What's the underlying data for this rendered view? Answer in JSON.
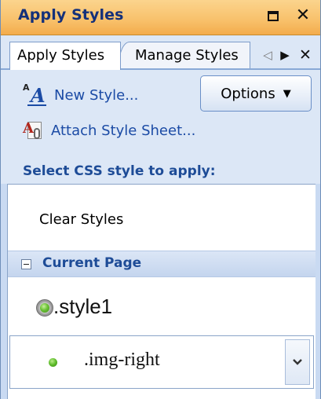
{
  "window": {
    "title": "Apply Styles",
    "maximize_icon": "maximize-icon",
    "close_glyph": "✕"
  },
  "tabs": {
    "items": [
      {
        "label": "Apply Styles",
        "active": true
      },
      {
        "label": "Manage Styles",
        "active": false
      }
    ],
    "scroll_left_glyph": "◁",
    "scroll_right_glyph": "▶",
    "close_glyph": "✕"
  },
  "toolbar": {
    "new_style_label": "New Style...",
    "attach_label": "Attach Style Sheet...",
    "options_label": "Options",
    "options_caret": "▼",
    "select_heading": "Select CSS style to apply:"
  },
  "style_list": {
    "clear_styles_label": "Clear Styles",
    "group_label": "Current Page",
    "styles": [
      {
        "name": ".style1",
        "icon": "radio-selected-icon"
      },
      {
        "name": ".img-right",
        "icon": "green-dot-icon"
      }
    ]
  },
  "colors": {
    "title_bar": "#f8c06a",
    "title_text": "#14307a",
    "link_blue": "#1b4ba5",
    "panel_bg": "#dce7f6",
    "group_header_bg": "#c4d5ee"
  }
}
